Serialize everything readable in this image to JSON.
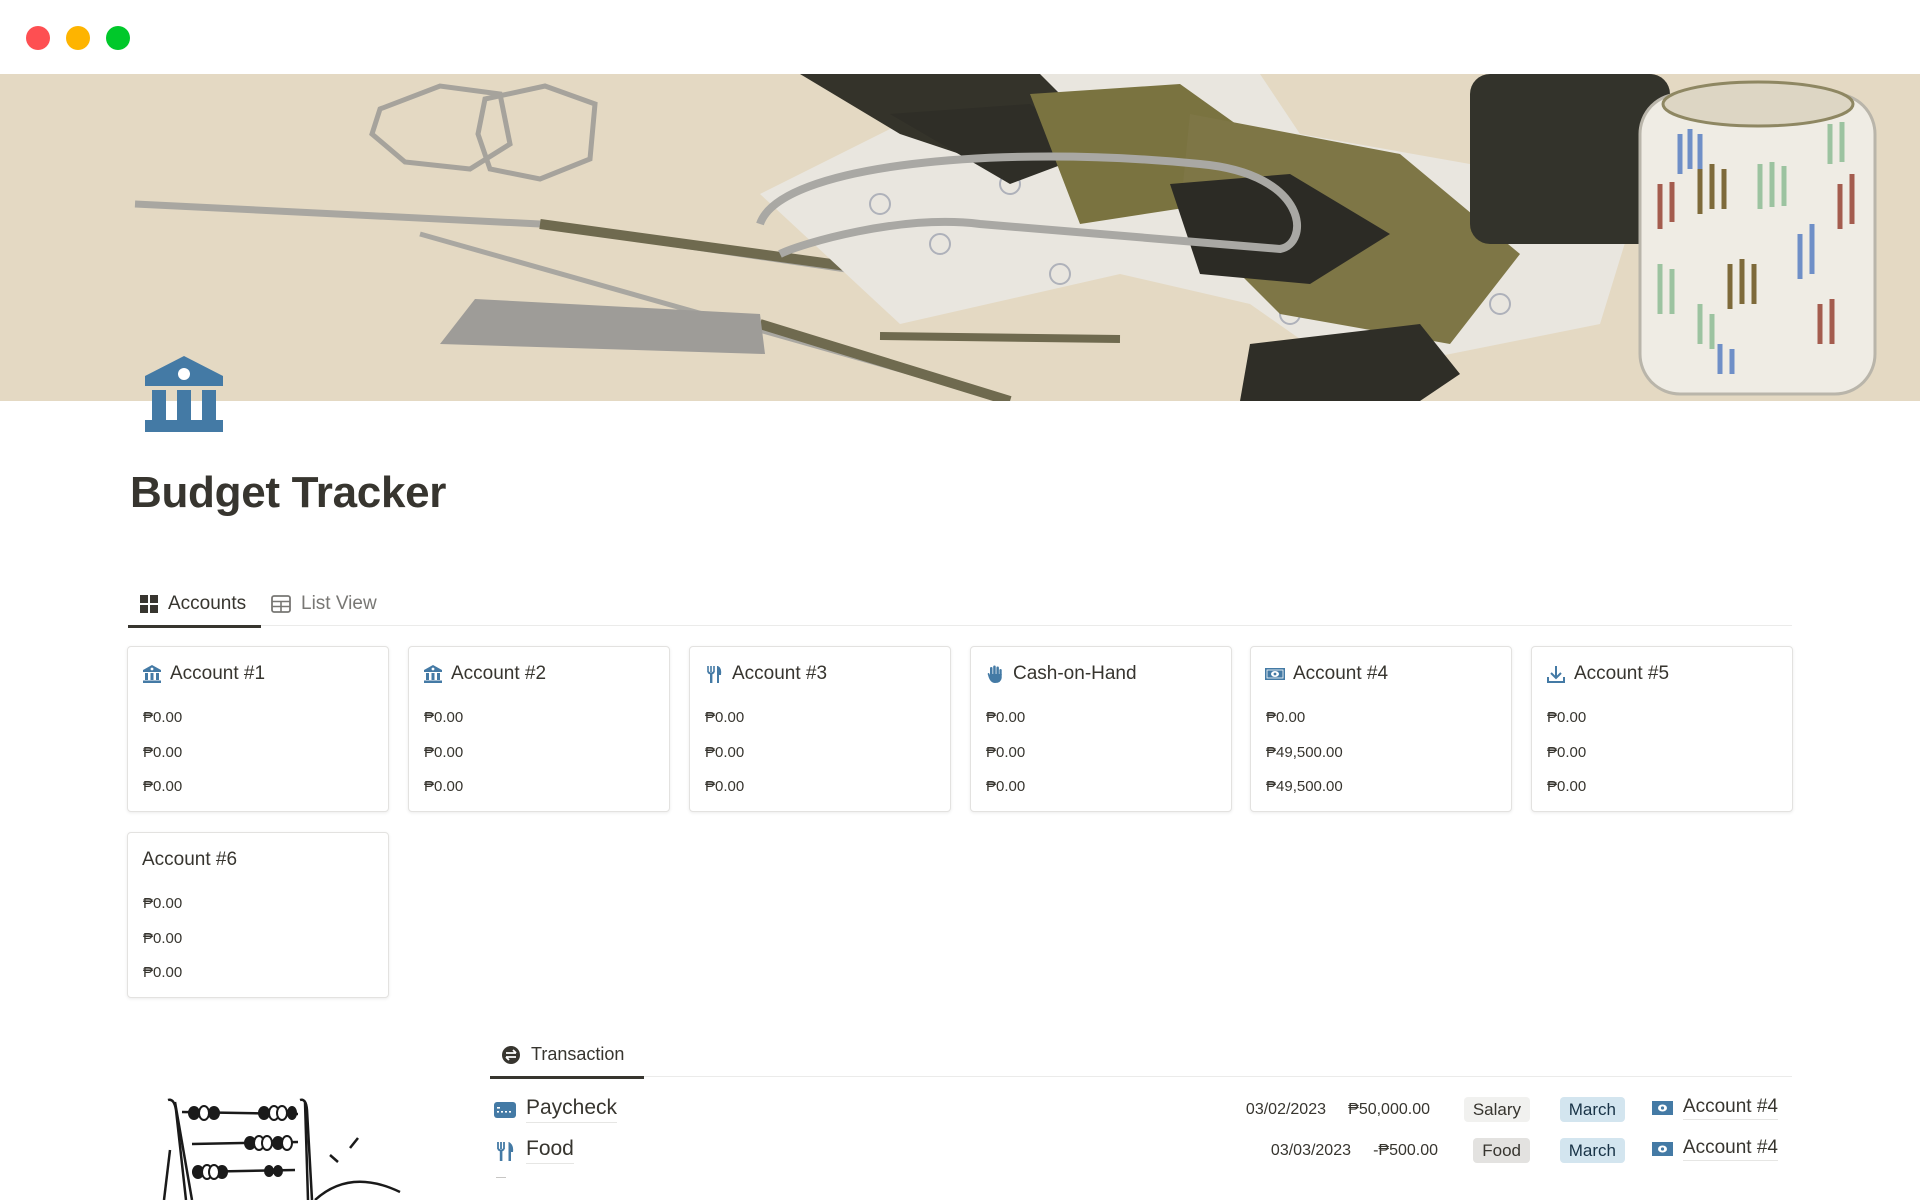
{
  "window": {
    "controls": [
      "close",
      "minimize",
      "maximize"
    ]
  },
  "page": {
    "icon": "bank-building-icon",
    "title": "Budget Tracker"
  },
  "colors": {
    "accent": "#447aa5",
    "text": "#37352f",
    "muted": "#787774"
  },
  "views": {
    "tabs": [
      {
        "label": "Accounts",
        "icon": "gallery-grid-icon",
        "active": true
      },
      {
        "label": "List View",
        "icon": "table-icon",
        "active": false
      }
    ]
  },
  "accounts": [
    {
      "name": "Account #1",
      "icon": "bank-icon",
      "values": [
        "₱0.00",
        "₱0.00",
        "₱0.00"
      ]
    },
    {
      "name": "Account #2",
      "icon": "bank-icon",
      "values": [
        "₱0.00",
        "₱0.00",
        "₱0.00"
      ]
    },
    {
      "name": "Account #3",
      "icon": "fork-knife-icon",
      "values": [
        "₱0.00",
        "₱0.00",
        "₱0.00"
      ]
    },
    {
      "name": "Cash-on-Hand",
      "icon": "hand-icon",
      "values": [
        "₱0.00",
        "₱0.00",
        "₱0.00"
      ]
    },
    {
      "name": "Account #4",
      "icon": "money-bill-icon",
      "values": [
        "₱0.00",
        "₱49,500.00",
        "₱49,500.00"
      ]
    },
    {
      "name": "Account #5",
      "icon": "download-icon",
      "values": [
        "₱0.00",
        "₱0.00",
        "₱0.00"
      ]
    },
    {
      "name": "Account #6",
      "icon": "",
      "values": [
        "₱0.00",
        "₱0.00",
        "₱0.00"
      ]
    }
  ],
  "transactions": {
    "tab": {
      "label": "Transaction",
      "icon": "exchange-arrows-icon"
    },
    "rows": [
      {
        "name": "Paycheck",
        "icon": "credit-card-icon",
        "date": "03/02/2023",
        "amount": "₱50,000.00",
        "category": "Salary",
        "month": "March",
        "account": "Account #4"
      },
      {
        "name": "Food",
        "icon": "fork-knife-icon",
        "date": "03/03/2023",
        "amount": "-₱500.00",
        "category": "Food",
        "month": "March",
        "account": "Account #4"
      }
    ]
  }
}
